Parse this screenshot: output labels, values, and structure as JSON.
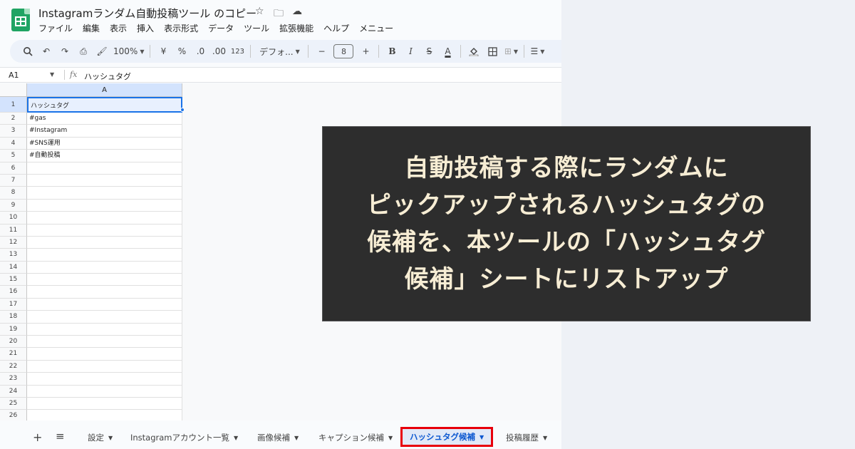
{
  "app": {
    "title": "Instagramランダム自動投稿ツール のコピー",
    "title_icons": [
      "star-icon",
      "folder-move-icon",
      "cloud-status-icon"
    ],
    "menu": [
      "ファイル",
      "編集",
      "表示",
      "挿入",
      "表示形式",
      "データ",
      "ツール",
      "拡張機能",
      "ヘルプ",
      "メニュー"
    ]
  },
  "toolbar": {
    "zoom": "100%",
    "currency": "¥",
    "percent": "%",
    "dec_decrease": ".0",
    "dec_increase": ".00",
    "number_format": "123",
    "font": "デフォ...",
    "minus": "−",
    "font_size": "8",
    "plus": "+",
    "bold": "B",
    "italic": "I",
    "strike": "S",
    "text_color": "A"
  },
  "formula_bar": {
    "cell_ref": "A1",
    "fx": "fx",
    "value": "ハッシュタグ"
  },
  "grid": {
    "column_header": "A",
    "rows": [
      {
        "num": "1",
        "value": "ハッシュタグ"
      },
      {
        "num": "2",
        "value": "#gas"
      },
      {
        "num": "3",
        "value": "#Instagram"
      },
      {
        "num": "4",
        "value": "#SNS運用"
      },
      {
        "num": "5",
        "value": "#自動投稿"
      },
      {
        "num": "6",
        "value": ""
      },
      {
        "num": "7",
        "value": ""
      },
      {
        "num": "8",
        "value": ""
      },
      {
        "num": "9",
        "value": ""
      },
      {
        "num": "10",
        "value": ""
      },
      {
        "num": "11",
        "value": ""
      },
      {
        "num": "12",
        "value": ""
      },
      {
        "num": "13",
        "value": ""
      },
      {
        "num": "14",
        "value": ""
      },
      {
        "num": "15",
        "value": ""
      },
      {
        "num": "16",
        "value": ""
      },
      {
        "num": "17",
        "value": ""
      },
      {
        "num": "18",
        "value": ""
      },
      {
        "num": "19",
        "value": ""
      },
      {
        "num": "20",
        "value": ""
      },
      {
        "num": "21",
        "value": ""
      },
      {
        "num": "22",
        "value": ""
      },
      {
        "num": "23",
        "value": ""
      },
      {
        "num": "24",
        "value": ""
      },
      {
        "num": "25",
        "value": ""
      },
      {
        "num": "26",
        "value": ""
      }
    ]
  },
  "sheets": {
    "add": "+",
    "menu": "≡",
    "tabs": [
      {
        "label": "設定"
      },
      {
        "label": "Instagramアカウント一覧"
      },
      {
        "label": "画像候補"
      },
      {
        "label": "キャプション候補"
      },
      {
        "label": "ハッシュタグ候補"
      },
      {
        "label": "投稿履歴"
      }
    ],
    "active_index": 4
  },
  "overlay": {
    "lines": [
      "自動投稿する際にランダムに",
      "ピックアップされるハッシュタグの",
      "候補を、本ツールの「ハッシュタグ",
      "候補」シートにリストアップ"
    ]
  },
  "colors": {
    "accent": "#1a73e8",
    "highlight_box": "#e8000b",
    "overlay_bg": "#2d2d2d",
    "overlay_text": "#f7edd4",
    "sheets_green": "#1fa463"
  }
}
